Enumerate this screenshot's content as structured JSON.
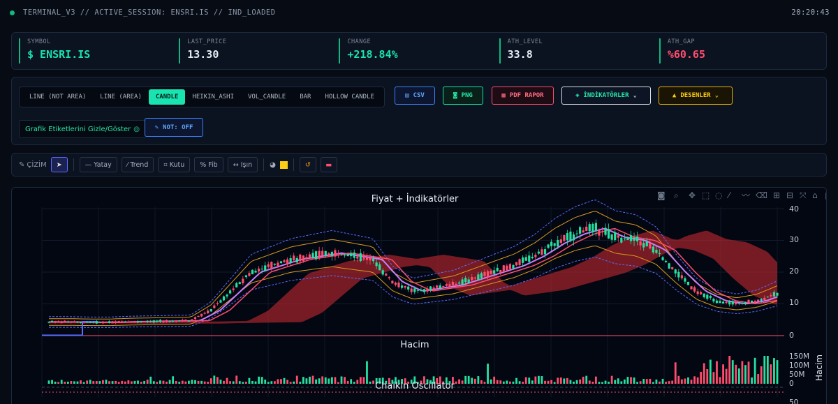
{
  "header": {
    "session": "TERMINAL_V3 // ACTIVE_SESSION: ENSRI.IS // IND_LOADED",
    "clock": "20:20:43"
  },
  "stats": [
    {
      "label": "SYMBOL",
      "value": "$ ENSRI.IS",
      "color": "#19e3b1"
    },
    {
      "label": "LAST_PRICE",
      "value": "13.30",
      "color": "#e6edf5"
    },
    {
      "label": "CHANGE",
      "value": "+218.84%",
      "color": "#19e3b1"
    },
    {
      "label": "ATH_LEVEL",
      "value": "33.8",
      "color": "#e6edf5"
    },
    {
      "label": "ATH_GAP",
      "value": "%60.65",
      "color": "#ff4d6d"
    }
  ],
  "chart_types": [
    "LINE (NOT AREA)",
    "LINE (AREA)",
    "CANDLE",
    "HEIKIN_ASHI",
    "VOL_CANDLE",
    "BAR",
    "HOLLOW CANDLE"
  ],
  "active_chart_type": "CANDLE",
  "actions": {
    "csv": "CSV",
    "png": "PNG",
    "pdf": "PDF RAPOR",
    "indicators": "İNDİKATÖRLER",
    "patterns": "DESENLER"
  },
  "label_toggle": "Grafik Etiketlerini Gizle/Göster",
  "note_toggle": "NOT: OFF",
  "draw_tools": {
    "title": "ÇİZİM",
    "horizontal": "Yatay",
    "trend": "Trend",
    "box": "Kutu",
    "fib": "Fib",
    "ray": "Işın"
  },
  "chart": {
    "title": "Fiyat + İndikatörler",
    "volume_title": "Hacim",
    "volume_axis_label": "Hacim",
    "oscillator_title": "Chaikin Oscillator",
    "price_ticks": [
      "40",
      "30",
      "20",
      "10",
      "0"
    ],
    "volume_ticks": [
      "150M",
      "100M",
      "50M",
      "0"
    ],
    "osc_tick": "50",
    "colors": {
      "up": "#26e0a0",
      "down": "#ff4d6d",
      "cloud": "#b3262e",
      "band": "#d99a1c",
      "bb": "#5b6cff",
      "ma": "#c77dff"
    }
  },
  "chart_data": {
    "type": "candlestick",
    "title": "Fiyat + İndikatörler",
    "ylim": [
      0,
      40
    ],
    "approx_close_path": [
      4.3,
      4.3,
      4.2,
      4.2,
      4.4,
      4.5,
      4.6,
      4.7,
      8,
      14,
      20,
      22,
      24,
      25,
      26,
      25,
      24,
      17,
      14,
      15,
      16,
      18,
      20,
      22,
      25,
      29,
      32,
      33.8,
      31,
      30,
      27,
      20,
      14,
      11,
      10,
      11,
      13.3
    ],
    "volume_ylim": [
      0,
      150
    ],
    "volume_unit": "M"
  }
}
